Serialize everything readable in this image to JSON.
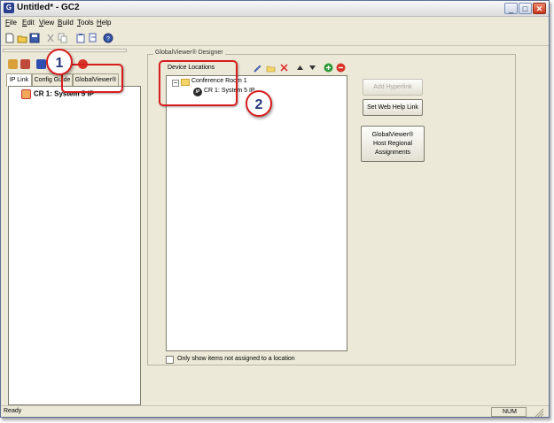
{
  "window": {
    "title": "Untitled* - GC2",
    "controls": {
      "minimize": "_",
      "maximize": "□",
      "close": "✕"
    }
  },
  "menubar": {
    "items": [
      {
        "label": "File",
        "key": "F",
        "rest": "ile"
      },
      {
        "label": "Edit",
        "key": "E",
        "rest": "dit"
      },
      {
        "label": "View",
        "key": "V",
        "rest": "iew"
      },
      {
        "label": "Build",
        "key": "B",
        "rest": "uild"
      },
      {
        "label": "Tools",
        "key": "T",
        "rest": "ools"
      },
      {
        "label": "Help",
        "key": "H",
        "rest": "elp"
      }
    ]
  },
  "toolbar": {
    "icons": [
      "new-icon",
      "open-icon",
      "save-icon",
      "cut-icon",
      "copy-icon",
      "paste-icon",
      "undo-icon",
      "help-icon"
    ]
  },
  "left_panel": {
    "tabs": [
      "IP Link",
      "Config Guide",
      "GlobalViewer®"
    ],
    "tree_item": "CR 1: System 5 IP"
  },
  "designer": {
    "group_title": "GlobalViewer® Designer",
    "device_locations_label": "Device Locations",
    "tree": {
      "room": "Conference Room 1",
      "device": "CR 1: System 5 IP",
      "device_icon_text": "IP"
    },
    "filter_checkbox": {
      "label": "Only show items not assigned to a location",
      "checked": false
    },
    "buttons": {
      "add_hyperlink": "Add Hyperlink",
      "set_web_help_link": "Set Web Help Link",
      "gv_host_line1": "GlobalViewer®",
      "gv_host_line2": "Host Regional",
      "gv_host_line3": "Assignments"
    }
  },
  "callouts": {
    "one": "1",
    "two": "2"
  },
  "statusbar": {
    "text": "Ready",
    "num": "NUM"
  },
  "colors": {
    "callout_red": "#d71d1d",
    "callout_number": "#26367a",
    "window_bg": "#ece9d8"
  }
}
